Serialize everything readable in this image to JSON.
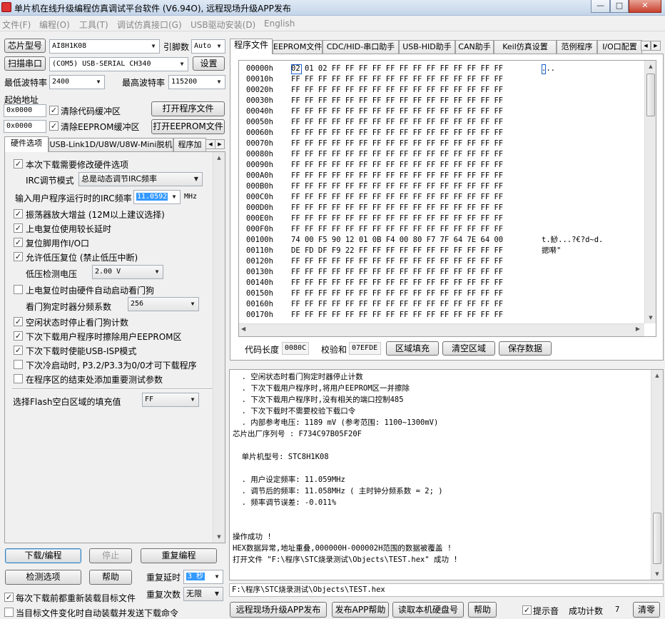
{
  "title": "单片机在线升级编程仿真调试平台软件 (V6.94O), 远程现场升级APP发布",
  "window_buttons": {
    "minimize": "—",
    "maximize": "□",
    "close": "✕"
  },
  "menu": [
    "文件(F)",
    "编程(O)",
    "工具(T)",
    "调试仿真接口(G)",
    "USB驱动安装(D)",
    "English"
  ],
  "left": {
    "chip_btn": "芯片型号",
    "chip_value": "AI8H1K08",
    "pin_label": "引脚数",
    "pin_value": "Auto",
    "scan_btn": "扫描串口",
    "port_value": "(COM5) USB-SERIAL CH340",
    "settings_btn": "设置",
    "min_baud_label": "最低波特率",
    "min_baud": "2400",
    "max_baud_label": "最高波特率",
    "max_baud": "115200",
    "start_addr_label": "起始地址",
    "addr1": "0x0000",
    "clear_code_label": "清除代码缓冲区",
    "open_prog_btn": "打开程序文件",
    "addr2": "0x0000",
    "clear_eeprom_label": "清除EEPROM缓冲区",
    "open_eeprom_btn": "打开EEPROM文件",
    "tabs": [
      "硬件选项",
      "USB-Link1D/U8W/U8W-Mini脱机",
      "程序加"
    ],
    "hw": {
      "opt_modify": "本次下载需要修改硬件选项",
      "irc_mode_label": "IRC调节模式",
      "irc_mode_value": "总是动态调节IRC频率",
      "irc_freq_label": "输入用户程序运行时的IRC频率",
      "irc_freq_value": "11.0592",
      "irc_unit": "MHz",
      "opt_osc_gain": "振荡器放大增益 (12M以上建议选择)",
      "opt_long_reset": "上电复位使用较长延时",
      "opt_reset_io": "复位脚用作I/O口",
      "opt_lvr": "允许低压复位 (禁止低压中断)",
      "lvd_label": "低压检测电压",
      "lvd_value": "2.00 V",
      "opt_wdt_hw": "上电复位时由硬件自动启动看门狗",
      "wdt_div_label": "看门狗定时器分频系数",
      "wdt_div_value": "256",
      "opt_wdt_idle": "空闲状态时停止看门狗计数",
      "opt_erase_eeprom": "下次下载用户程序时擦除用户EEPROM区",
      "opt_usb_isp": "下次下载时使能USB-ISP模式",
      "opt_cold_boot": "下次冷启动时, P3.2/P3.3为0/0才可下载程序",
      "opt_test_param": "在程序区的结束处添加重要测试参数",
      "fill_label": "选择Flash空白区域的填充值",
      "fill_value": "FF"
    },
    "download_btn": "下载/编程",
    "stop_btn": "停止",
    "reprog_btn": "重复编程",
    "detect_btn": "检测选项",
    "help_btn": "帮助",
    "repeat_delay_label": "重复延时",
    "repeat_delay_value": "3 秒",
    "repeat_count_label": "重复次数",
    "repeat_count_value": "无限",
    "reload_label": "每次下载前都重新装载目标文件",
    "autoload_label": "当目标文件变化时自动装载并发送下载命令"
  },
  "right": {
    "tabs": [
      "程序文件",
      "EEPROM文件",
      "CDC/HID-串口助手",
      "USB-HID助手",
      "CAN助手",
      "Keil仿真设置",
      "范例程序",
      "I/O口配置"
    ],
    "hex_rows": [
      {
        "addr": "00000h",
        "bytes": "02 01 02 FF FF FF FF FF FF FF FF FF FF FF FF FF",
        "ascii": "..."
      },
      {
        "addr": "00010h",
        "bytes": "FF FF FF FF FF FF FF FF FF FF FF FF FF FF FF FF",
        "ascii": ""
      },
      {
        "addr": "00020h",
        "bytes": "FF FF FF FF FF FF FF FF FF FF FF FF FF FF FF FF",
        "ascii": ""
      },
      {
        "addr": "00030h",
        "bytes": "FF FF FF FF FF FF FF FF FF FF FF FF FF FF FF FF",
        "ascii": ""
      },
      {
        "addr": "00040h",
        "bytes": "FF FF FF FF FF FF FF FF FF FF FF FF FF FF FF FF",
        "ascii": ""
      },
      {
        "addr": "00050h",
        "bytes": "FF FF FF FF FF FF FF FF FF FF FF FF FF FF FF FF",
        "ascii": ""
      },
      {
        "addr": "00060h",
        "bytes": "FF FF FF FF FF FF FF FF FF FF FF FF FF FF FF FF",
        "ascii": ""
      },
      {
        "addr": "00070h",
        "bytes": "FF FF FF FF FF FF FF FF FF FF FF FF FF FF FF FF",
        "ascii": ""
      },
      {
        "addr": "00080h",
        "bytes": "FF FF FF FF FF FF FF FF FF FF FF FF FF FF FF FF",
        "ascii": ""
      },
      {
        "addr": "00090h",
        "bytes": "FF FF FF FF FF FF FF FF FF FF FF FF FF FF FF FF",
        "ascii": ""
      },
      {
        "addr": "000A0h",
        "bytes": "FF FF FF FF FF FF FF FF FF FF FF FF FF FF FF FF",
        "ascii": ""
      },
      {
        "addr": "000B0h",
        "bytes": "FF FF FF FF FF FF FF FF FF FF FF FF FF FF FF FF",
        "ascii": ""
      },
      {
        "addr": "000C0h",
        "bytes": "FF FF FF FF FF FF FF FF FF FF FF FF FF FF FF FF",
        "ascii": ""
      },
      {
        "addr": "000D0h",
        "bytes": "FF FF FF FF FF FF FF FF FF FF FF FF FF FF FF FF",
        "ascii": ""
      },
      {
        "addr": "000E0h",
        "bytes": "FF FF FF FF FF FF FF FF FF FF FF FF FF FF FF FF",
        "ascii": ""
      },
      {
        "addr": "000F0h",
        "bytes": "FF FF FF FF FF FF FF FF FF FF FF FF FF FF FF FF",
        "ascii": ""
      },
      {
        "addr": "00100h",
        "bytes": "74 00 F5 90 12 01 0B F4 00 80 F7 7F 64 7E 64 00",
        "ascii": "t.鯋...?€?d~d."
      },
      {
        "addr": "00110h",
        "bytes": "DE FD DF F9 22 FF FF FF FF FF FF FF FF FF FF FF",
        "ascii": "揌啭\""
      },
      {
        "addr": "00120h",
        "bytes": "FF FF FF FF FF FF FF FF FF FF FF FF FF FF FF FF",
        "ascii": ""
      },
      {
        "addr": "00130h",
        "bytes": "FF FF FF FF FF FF FF FF FF FF FF FF FF FF FF FF",
        "ascii": ""
      },
      {
        "addr": "00140h",
        "bytes": "FF FF FF FF FF FF FF FF FF FF FF FF FF FF FF FF",
        "ascii": ""
      },
      {
        "addr": "00150h",
        "bytes": "FF FF FF FF FF FF FF FF FF FF FF FF FF FF FF FF",
        "ascii": ""
      },
      {
        "addr": "00160h",
        "bytes": "FF FF FF FF FF FF FF FF FF FF FF FF FF FF FF FF",
        "ascii": ""
      },
      {
        "addr": "00170h",
        "bytes": "FF FF FF FF FF FF FF FF FF FF FF FF FF FF FF FF",
        "ascii": ""
      }
    ],
    "code_len_label": "代码长度",
    "code_len_value": "0080C",
    "checksum_label": "校验和",
    "checksum_value": "07EFDE",
    "fill_btn": "区域填充",
    "clear_btn": "清空区域",
    "save_btn": "保存数据",
    "log_lines": [
      "  . 空闲状态时看门狗定时器停止计数",
      "  . 下次下载用户程序时,将用户EEPROM区一并擦除",
      "  . 下次下载用户程序时,没有相关的端口控制485",
      "  . 下次下载时不需要校验下载口令",
      "  . 内部参考电压: 1189 mV (参考范围: 1100~1300mV)",
      "芯片出厂序列号 : F734C97B05F20F",
      "",
      "  单片机型号: STC8H1K08",
      "",
      "  . 用户设定频率: 11.059MHz",
      "  . 调节后的频率: 11.058MHz ( 主时钟分频系数 = 2; )",
      "  . 频率调节误差: -0.011%",
      "",
      "",
      "操作成功 !",
      "HEX数据异常,地址重叠,000000H-000002H范围的数据被覆盖 !",
      "打开文件 \"F:\\程序\\STC烧录测试\\Objects\\TEST.hex\" 成功 !"
    ],
    "filepath": "F:\\程序\\STC烧录测试\\Objects\\TEST.hex",
    "remote_btn": "远程现场升级APP发布",
    "publish_help_btn": "发布APP帮助",
    "read_disk_btn": "读取本机硬盘号",
    "help2_btn": "帮助",
    "beep_label": "提示音",
    "success_label": "成功计数",
    "success_value": "7",
    "reset_btn": "清零"
  }
}
